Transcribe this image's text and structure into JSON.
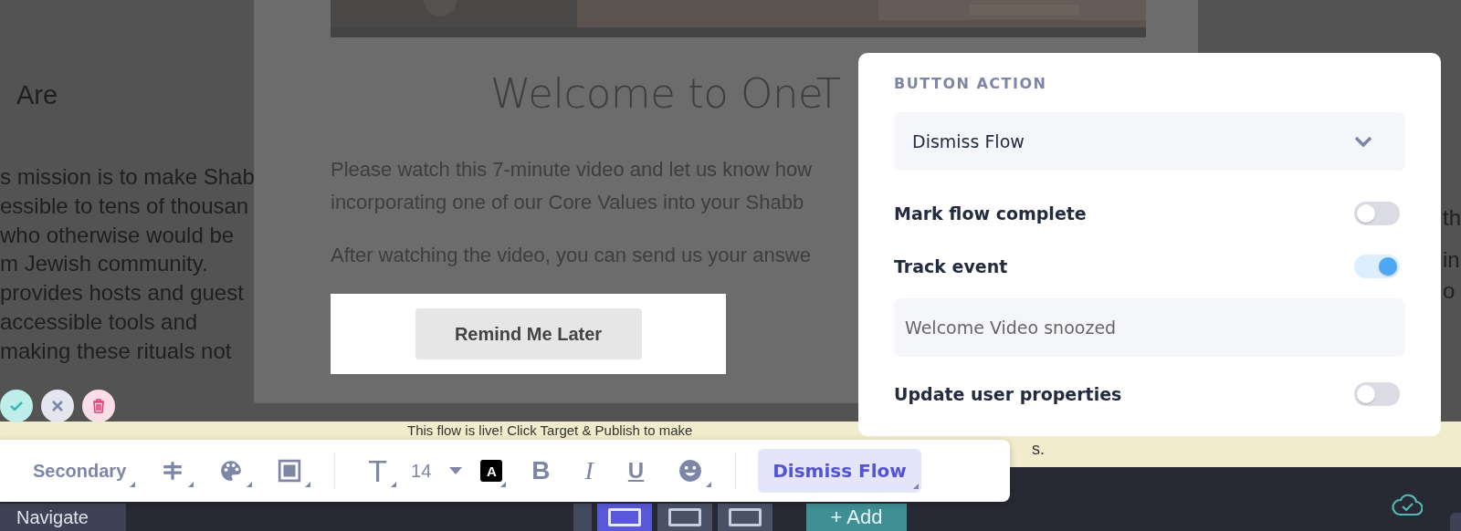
{
  "page_background": {
    "heading": "Are",
    "lines": [
      "s mission is to make Shab",
      "essible to tens of thousan",
      "who otherwise would be",
      "m Jewish community.",
      "provides hosts and guest",
      " accessible tools and",
      "making these rituals not"
    ],
    "right_fragments": [
      "th",
      "in",
      "o"
    ]
  },
  "modal": {
    "title": "Welcome to OneT",
    "paragraphs": [
      "Please watch this 7-minute video and let us know how",
      "incorporating one of our Core Values into your Shabb",
      "After watching the video, you can send us your answe"
    ],
    "button": "Remind Me Later"
  },
  "block_actions": [
    {
      "kind": "confirm"
    },
    {
      "kind": "cancel"
    },
    {
      "kind": "delete"
    }
  ],
  "banner": {
    "text": "This flow is live! Click Target & Publish to make",
    "tail": "s."
  },
  "toolbar": {
    "tools": [
      {
        "kind": "style",
        "label": "Secondary"
      },
      {
        "kind": "spacing"
      },
      {
        "kind": "palette"
      },
      {
        "kind": "frame"
      },
      {
        "kind": "divider"
      },
      {
        "kind": "font",
        "glyph": "T"
      },
      {
        "kind": "size",
        "label": "14"
      },
      {
        "kind": "color",
        "glyph": "A"
      },
      {
        "kind": "bold",
        "glyph": "B"
      },
      {
        "kind": "italic",
        "glyph": "I"
      },
      {
        "kind": "underline",
        "glyph": "U"
      },
      {
        "kind": "emoji"
      },
      {
        "kind": "divider"
      },
      {
        "kind": "action",
        "label": "Dismiss Flow"
      }
    ]
  },
  "popover": {
    "heading": "BUTTON ACTION",
    "action_select": "Dismiss Flow",
    "rows": [
      {
        "kind": "toggle",
        "label": "Mark flow complete",
        "on": false
      },
      {
        "kind": "toggle",
        "label": "Track event",
        "on": true
      },
      {
        "kind": "input",
        "value": "Welcome Video snoozed"
      },
      {
        "kind": "toggle",
        "label": "Update user properties",
        "on": false
      }
    ]
  },
  "bottom_bar": {
    "navigate": "Navigate",
    "steps": [
      {
        "selected": true
      },
      {
        "selected": false
      },
      {
        "selected": false
      }
    ],
    "add_button": "+ Add"
  }
}
